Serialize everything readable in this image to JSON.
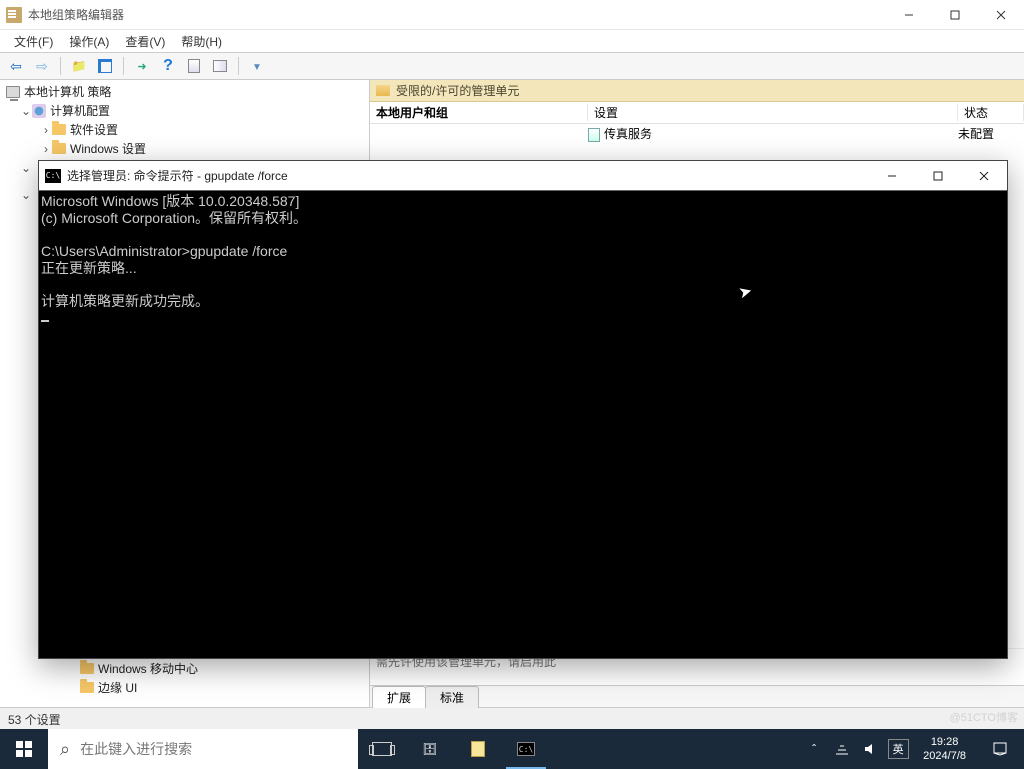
{
  "gpedit": {
    "title": "本地组策略编辑器",
    "menu": {
      "file": "文件(F)",
      "action": "操作(A)",
      "view": "查看(V)",
      "help": "帮助(H)"
    },
    "tree": {
      "root": "本地计算机 策略",
      "computer_cfg": "计算机配置",
      "software": "软件设置",
      "windows": "Windows 设置",
      "win_mobile": "Windows 移动中心",
      "edge_ui": "边缘 UI"
    },
    "right": {
      "header": "受限的/许可的管理单元",
      "col_title": "本地用户和组",
      "col_setting": "设置",
      "col_state": "状态",
      "row1_setting": "传真服务",
      "row1_state": "未配置",
      "foot_note": "需先许使用该管理单元，请启用此",
      "tab_ext": "扩展",
      "tab_std": "标准"
    },
    "status": "53 个设置"
  },
  "cmd": {
    "title": "选择管理员: 命令提示符 - gpupdate  /force",
    "line1": "Microsoft Windows [版本 10.0.20348.587]",
    "line2": "(c) Microsoft Corporation。保留所有权利。",
    "prompt": "C:\\Users\\Administrator>",
    "command": "gpupdate /force",
    "line3": "正在更新策略...",
    "line4": "计算机策略更新成功完成。"
  },
  "taskbar": {
    "search_placeholder": "在此键入进行搜索",
    "ime": "英",
    "time": "19:28",
    "date": "2024/7/8"
  },
  "watermark": "@51CTO博客"
}
